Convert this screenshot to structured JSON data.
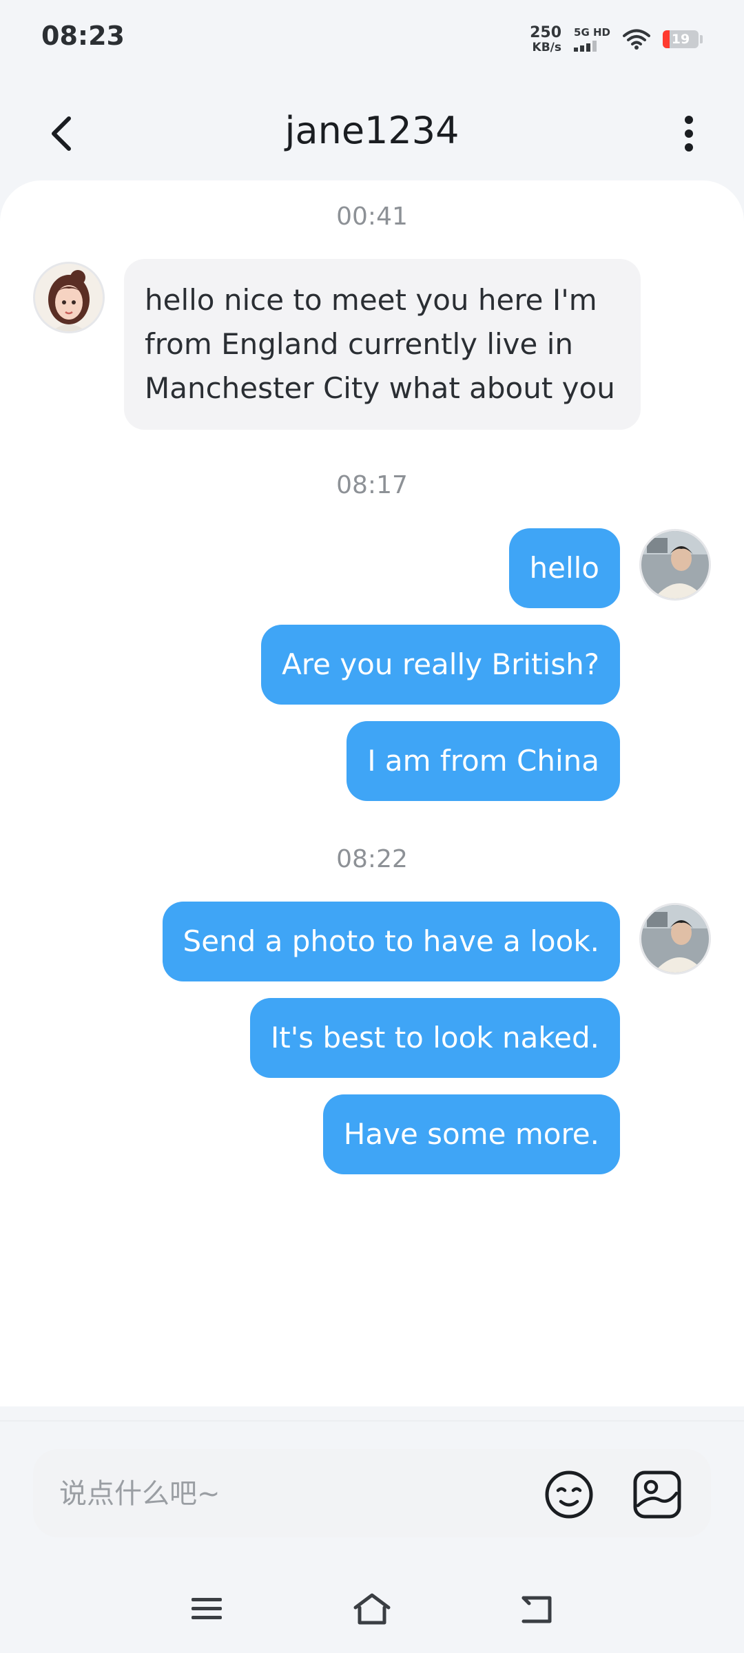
{
  "status_bar": {
    "time": "08:23",
    "net_speed_value": "250",
    "net_speed_unit": "KB/s",
    "network_label": "5G HD",
    "battery_level": "19",
    "battery_color": "#ff3b30"
  },
  "header": {
    "title": "jane1234",
    "back_icon": "chevron-left-icon",
    "more_icon": "more-vertical-icon"
  },
  "messages": [
    {
      "type": "timestamp",
      "text": "00:41"
    },
    {
      "type": "incoming",
      "sender": "jane1234",
      "text": "hello nice to meet you here I'm from England currently live in Manchester City what about you"
    },
    {
      "type": "timestamp",
      "text": "08:17"
    },
    {
      "type": "outgoing",
      "text": "hello"
    },
    {
      "type": "outgoing",
      "text": "Are you really British?"
    },
    {
      "type": "outgoing",
      "text": "I am from China"
    },
    {
      "type": "timestamp",
      "text": "08:22"
    },
    {
      "type": "outgoing",
      "text": "Send a photo to have a look."
    },
    {
      "type": "outgoing",
      "text": "It's best to look naked."
    },
    {
      "type": "outgoing",
      "text": "Have some more."
    }
  ],
  "input": {
    "placeholder": "说点什么吧~",
    "value": "",
    "emoji_icon": "emoji-icon",
    "image_icon": "image-icon"
  },
  "nav_bar": {
    "items": [
      "menu-icon",
      "home-icon",
      "back-icon"
    ]
  },
  "colors": {
    "accent": "#3fa5f6",
    "incoming_bubble": "#f3f3f5",
    "background": "#f3f5f8"
  }
}
